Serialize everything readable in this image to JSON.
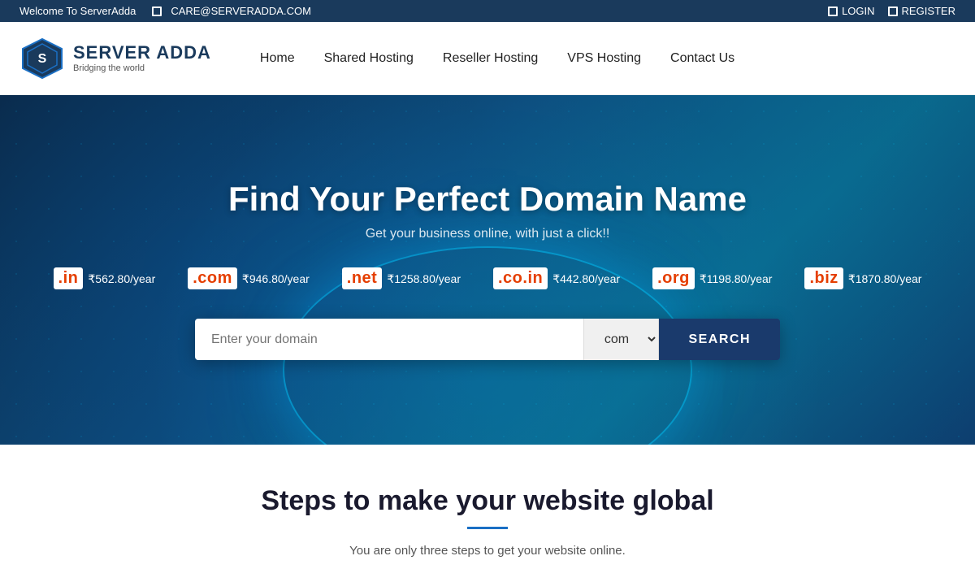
{
  "topbar": {
    "welcome": "Welcome To ServerAdda",
    "email": "CARE@SERVERADDA.COM",
    "login_label": "LOGIN",
    "register_label": "REGISTER"
  },
  "navbar": {
    "logo_name": "SERVER ADDA",
    "logo_tagline": "Bridging the world",
    "nav_home": "Home",
    "nav_shared": "Shared Hosting",
    "nav_reseller": "Reseller Hosting",
    "nav_vps": "VPS Hosting",
    "nav_contact": "Contact Us"
  },
  "hero": {
    "title": "Find Your Perfect Domain Name",
    "subtitle": "Get your business online, with just a click!!",
    "search_placeholder": "Enter your domain",
    "search_tld": "com",
    "search_btn": "SEARCH",
    "domains": [
      {
        "ext": ".in",
        "price": "₹562.80/year"
      },
      {
        "ext": ".com",
        "price": "₹946.80/year"
      },
      {
        "ext": ".net",
        "price": "₹1258.80/year"
      },
      {
        "ext": ".co.in",
        "price": "₹442.80/year"
      },
      {
        "ext": ".org",
        "price": "₹1198.80/year"
      },
      {
        "ext": ".biz",
        "price": "₹1870.80/year"
      }
    ]
  },
  "steps": {
    "title": "Steps to make your website global",
    "subtitle": "You are only three steps to get your website online."
  }
}
